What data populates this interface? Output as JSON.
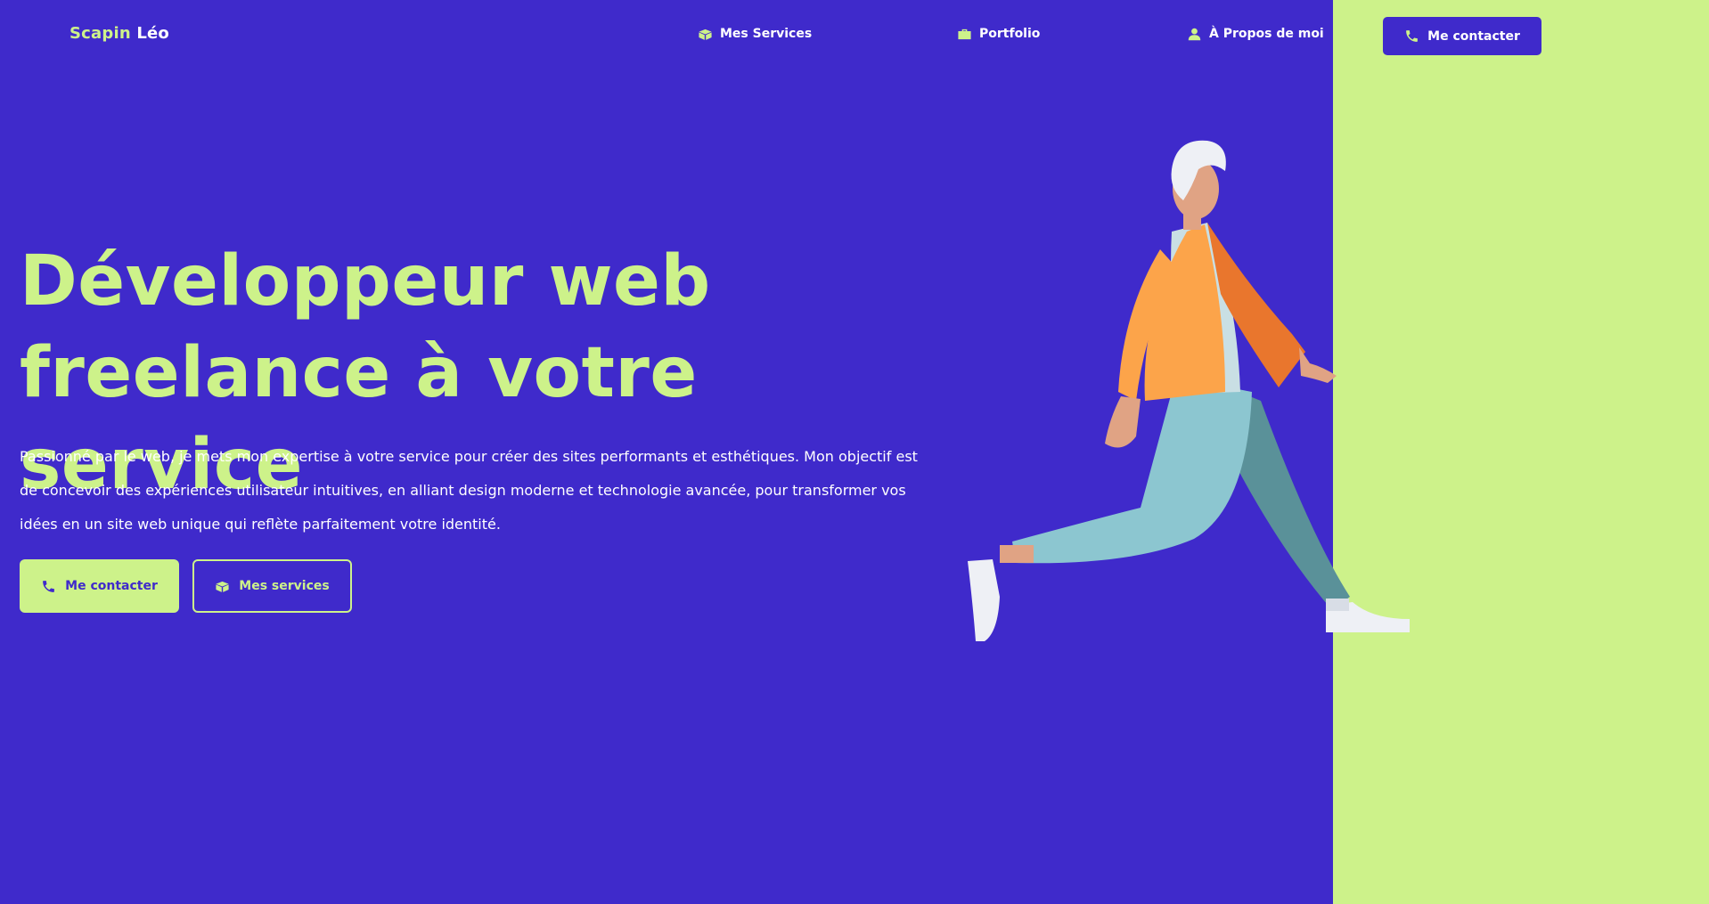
{
  "nav": {
    "brand_first": "Scapin",
    "brand_last": " Léo",
    "links": [
      {
        "label": "Mes Services",
        "icon": "box-open-icon"
      },
      {
        "label": "Portfolio",
        "icon": "briefcase-icon"
      },
      {
        "label": "À Propos de moi",
        "icon": "user-icon"
      }
    ],
    "cta_label": "Me contacter"
  },
  "hero": {
    "title_line1": "Développeur web",
    "title_line2": "freelance à votre service",
    "text": "Passionné par le web, je mets mon expertise à votre service pour créer des sites performants et esthétiques. Mon objectif est de concevoir des expériences utilisateur intuitives, en alliant design moderne et technologie avancée, pour transformer vos idées en un site web unique qui reflète parfaitement votre identité.",
    "primary_button": "Me contacter",
    "secondary_button": "Mes services"
  },
  "colors": {
    "primary": "#3f2acb",
    "accent": "#cdf28a",
    "text": "#ffffff"
  }
}
